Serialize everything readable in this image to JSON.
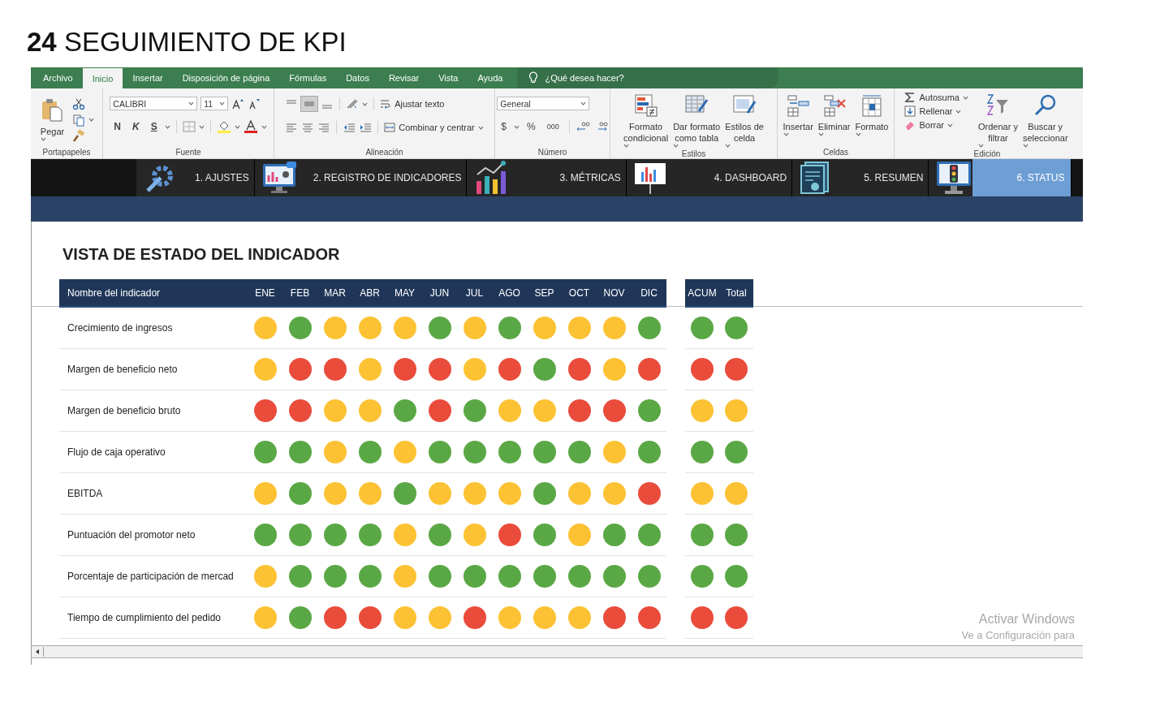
{
  "document_title": "**24** SEGUIMIENTO DE KPI",
  "ribbon": {
    "tabs": [
      {
        "label": "Archivo",
        "selected": false
      },
      {
        "label": "Inicio",
        "selected": true
      },
      {
        "label": "Insertar",
        "selected": false
      },
      {
        "label": "Disposición de página",
        "selected": false
      },
      {
        "label": "Fórmulas",
        "selected": false
      },
      {
        "label": "Datos",
        "selected": false
      },
      {
        "label": "Revisar",
        "selected": false
      },
      {
        "label": "Vista",
        "selected": false
      },
      {
        "label": "Ayuda",
        "selected": false
      }
    ],
    "tell_me": "¿Qué desea hacer?",
    "groups": [
      {
        "kind": "clipboard",
        "label": "Portapapeles",
        "paste": "Pegar"
      },
      {
        "kind": "font",
        "label": "Fuente",
        "font": "CALIBRI",
        "size": "11",
        "styles": [
          "N",
          "K",
          "S"
        ]
      },
      {
        "kind": "alignment",
        "label": "Alineación",
        "wrap": "Ajustar texto",
        "merge": "Combinar y centrar"
      },
      {
        "kind": "number",
        "label": "Número",
        "format": "General",
        "symbols": [
          "$",
          "%",
          "000"
        ]
      },
      {
        "kind": "large",
        "label": "Estilos",
        "buttons": [
          [
            "Formato",
            "condicional"
          ],
          [
            "Dar formato",
            "como tabla"
          ],
          [
            "Estilos de",
            "celda"
          ]
        ]
      },
      {
        "kind": "large",
        "label": "Celdas",
        "buttons": [
          [
            "Insertar"
          ],
          [
            "Eliminar"
          ],
          [
            "Formato"
          ]
        ]
      },
      {
        "kind": "editing",
        "label": "Edición",
        "small": [
          "Autosuma",
          "Rellenar",
          "Borrar"
        ],
        "buttons": [
          [
            "Ordenar y",
            "filtrar"
          ],
          [
            "Buscar y",
            "seleccionar"
          ]
        ]
      }
    ]
  },
  "nav": {
    "items": [
      {
        "label": "1. AJUSTES",
        "selected": false
      },
      {
        "label": "2. REGISTRO DE INDICADORES",
        "selected": false
      },
      {
        "label": "3. MÉTRICAS",
        "selected": false
      },
      {
        "label": "4. DASHBOARD",
        "selected": false
      },
      {
        "label": "5. RESUMEN",
        "selected": false
      },
      {
        "label": "6. STATUS",
        "selected": true
      }
    ]
  },
  "sheet": {
    "title": "VISTA DE ESTADO DEL INDICADOR",
    "columns": [
      "Nombre del indicador",
      "ENE",
      "FEB",
      "MAR",
      "ABR",
      "MAY",
      "JUN",
      "JUL",
      "AGO",
      "SEP",
      "OCT",
      "NOV",
      "DIC"
    ],
    "summary_columns": [
      "ACUM",
      "Total"
    ],
    "rows": [
      {
        "name": "Crecimiento de ingresos",
        "months": [
          {
            "color": "#fcc233"
          },
          {
            "color": "#5aa845"
          },
          {
            "color": "#fcc233"
          },
          {
            "color": "#fcc233"
          },
          {
            "color": "#fcc233"
          },
          {
            "color": "#5aa845"
          },
          {
            "color": "#fcc233"
          },
          {
            "color": "#5aa845"
          },
          {
            "color": "#fcc233"
          },
          {
            "color": "#fcc233"
          },
          {
            "color": "#fcc233"
          },
          {
            "color": "#5aa845"
          }
        ],
        "summary": [
          {
            "color": "#5aa845"
          },
          {
            "color": "#5aa845"
          }
        ]
      },
      {
        "name": "Margen de beneficio neto",
        "months": [
          {
            "color": "#fcc233"
          },
          {
            "color": "#ea4c3b"
          },
          {
            "color": "#ea4c3b"
          },
          {
            "color": "#fcc233"
          },
          {
            "color": "#ea4c3b"
          },
          {
            "color": "#ea4c3b"
          },
          {
            "color": "#fcc233"
          },
          {
            "color": "#ea4c3b"
          },
          {
            "color": "#5aa845"
          },
          {
            "color": "#ea4c3b"
          },
          {
            "color": "#fcc233"
          },
          {
            "color": "#ea4c3b"
          }
        ],
        "summary": [
          {
            "color": "#ea4c3b"
          },
          {
            "color": "#ea4c3b"
          }
        ]
      },
      {
        "name": "Margen de beneficio bruto",
        "months": [
          {
            "color": "#ea4c3b"
          },
          {
            "color": "#ea4c3b"
          },
          {
            "color": "#fcc233"
          },
          {
            "color": "#fcc233"
          },
          {
            "color": "#5aa845"
          },
          {
            "color": "#ea4c3b"
          },
          {
            "color": "#5aa845"
          },
          {
            "color": "#fcc233"
          },
          {
            "color": "#fcc233"
          },
          {
            "color": "#ea4c3b"
          },
          {
            "color": "#ea4c3b"
          },
          {
            "color": "#5aa845"
          }
        ],
        "summary": [
          {
            "color": "#fcc233"
          },
          {
            "color": "#fcc233"
          }
        ]
      },
      {
        "name": "Flujo de caja operativo",
        "months": [
          {
            "color": "#5aa845"
          },
          {
            "color": "#5aa845"
          },
          {
            "color": "#fcc233"
          },
          {
            "color": "#5aa845"
          },
          {
            "color": "#fcc233"
          },
          {
            "color": "#5aa845"
          },
          {
            "color": "#5aa845"
          },
          {
            "color": "#5aa845"
          },
          {
            "color": "#5aa845"
          },
          {
            "color": "#5aa845"
          },
          {
            "color": "#fcc233"
          },
          {
            "color": "#5aa845"
          }
        ],
        "summary": [
          {
            "color": "#5aa845"
          },
          {
            "color": "#5aa845"
          }
        ]
      },
      {
        "name": "EBITDA",
        "months": [
          {
            "color": "#fcc233"
          },
          {
            "color": "#5aa845"
          },
          {
            "color": "#fcc233"
          },
          {
            "color": "#fcc233"
          },
          {
            "color": "#5aa845"
          },
          {
            "color": "#fcc233"
          },
          {
            "color": "#fcc233"
          },
          {
            "color": "#fcc233"
          },
          {
            "color": "#5aa845"
          },
          {
            "color": "#fcc233"
          },
          {
            "color": "#fcc233"
          },
          {
            "color": "#ea4c3b"
          }
        ],
        "summary": [
          {
            "color": "#fcc233"
          },
          {
            "color": "#fcc233"
          }
        ]
      },
      {
        "name": "Puntuación del promotor neto",
        "months": [
          {
            "color": "#5aa845"
          },
          {
            "color": "#5aa845"
          },
          {
            "color": "#5aa845"
          },
          {
            "color": "#5aa845"
          },
          {
            "color": "#fcc233"
          },
          {
            "color": "#5aa845"
          },
          {
            "color": "#fcc233"
          },
          {
            "color": "#ea4c3b"
          },
          {
            "color": "#5aa845"
          },
          {
            "color": "#fcc233"
          },
          {
            "color": "#5aa845"
          },
          {
            "color": "#5aa845"
          }
        ],
        "summary": [
          {
            "color": "#5aa845"
          },
          {
            "color": "#5aa845"
          }
        ]
      },
      {
        "name": "Porcentaje de participación de mercad",
        "months": [
          {
            "color": "#fcc233"
          },
          {
            "color": "#5aa845"
          },
          {
            "color": "#5aa845"
          },
          {
            "color": "#5aa845"
          },
          {
            "color": "#fcc233"
          },
          {
            "color": "#5aa845"
          },
          {
            "color": "#5aa845"
          },
          {
            "color": "#5aa845"
          },
          {
            "color": "#5aa845"
          },
          {
            "color": "#5aa845"
          },
          {
            "color": "#5aa845"
          },
          {
            "color": "#5aa845"
          }
        ],
        "summary": [
          {
            "color": "#5aa845"
          },
          {
            "color": "#5aa845"
          }
        ]
      },
      {
        "name": "Tiempo de cumplimiento del pedido",
        "months": [
          {
            "color": "#fcc233"
          },
          {
            "color": "#5aa845"
          },
          {
            "color": "#ea4c3b"
          },
          {
            "color": "#ea4c3b"
          },
          {
            "color": "#fcc233"
          },
          {
            "color": "#fcc233"
          },
          {
            "color": "#ea4c3b"
          },
          {
            "color": "#fcc233"
          },
          {
            "color": "#fcc233"
          },
          {
            "color": "#fcc233"
          },
          {
            "color": "#ea4c3b"
          },
          {
            "color": "#ea4c3b"
          }
        ],
        "summary": [
          {
            "color": "#ea4c3b"
          },
          {
            "color": "#ea4c3b"
          }
        ]
      }
    ]
  },
  "windows_notice": {
    "title": "Activar Windows",
    "text": "Ve a Configuración para"
  }
}
